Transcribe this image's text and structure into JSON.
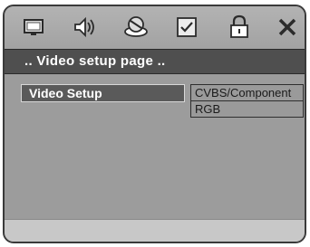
{
  "toolbar": {
    "icons": [
      {
        "name": "general-setup-icon"
      },
      {
        "name": "audio-setup-icon"
      },
      {
        "name": "video-setup-icon"
      },
      {
        "name": "preference-icon"
      },
      {
        "name": "password-lock-icon"
      },
      {
        "name": "exit-icon"
      }
    ]
  },
  "title_bar": {
    "text": ".. Video setup  page .."
  },
  "menu": {
    "items": [
      {
        "label": "Video Setup"
      }
    ]
  },
  "options": {
    "items": [
      {
        "label": "CVBS/Component"
      },
      {
        "label": "RGB"
      }
    ]
  },
  "status_bar": {
    "text": ""
  }
}
